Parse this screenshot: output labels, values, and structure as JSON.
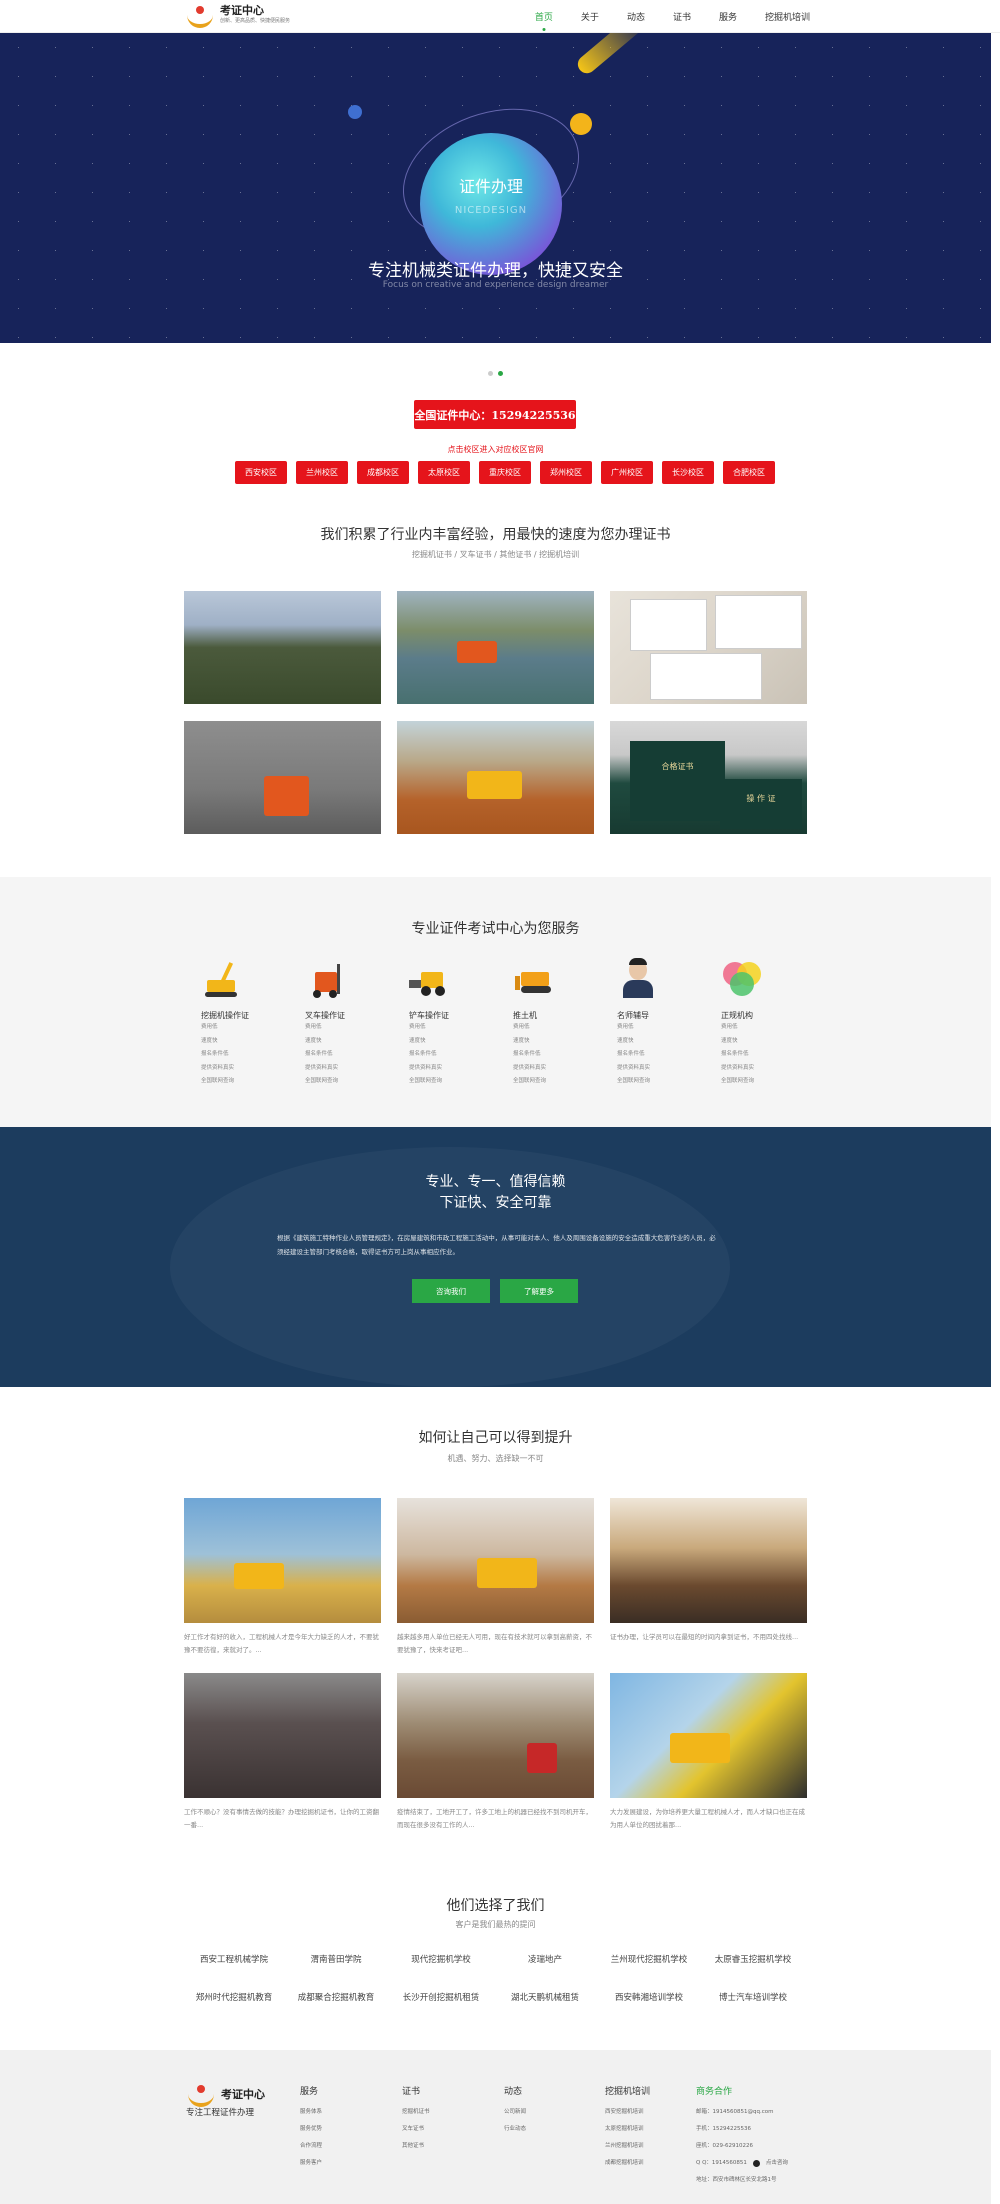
{
  "header": {
    "logo_title": "考证中心",
    "logo_tagline": "创新、更高品质、快捷便民服务",
    "nav": [
      "首页",
      "关于",
      "动态",
      "证书",
      "服务",
      "挖掘机培训"
    ]
  },
  "banner": {
    "globe_title": "证件办理",
    "globe_sub": "NICEDESIGN",
    "title": "专注机械类证件办理，快捷又安全",
    "subtitle": "Focus on creative and experience design dreamer"
  },
  "hotline": "全国证件中心：15294225536",
  "campus_link": "点击校区进入对应校区官网",
  "campuses": [
    "西安校区",
    "兰州校区",
    "成都校区",
    "太原校区",
    "重庆校区",
    "郑州校区",
    "广州校区",
    "长沙校区",
    "合肥校区"
  ],
  "experience": {
    "title": "我们积累了行业内丰富经验，用最快的速度为您办理证书",
    "tags": "挖掘机证书 / 叉车证书 / 其他证书 / 挖掘机培训"
  },
  "services": {
    "title": "专业证件考试中心为您服务",
    "items": [
      {
        "name": "挖掘机操作证",
        "icon": "excavator-icon"
      },
      {
        "name": "叉车操作证",
        "icon": "forklift-icon"
      },
      {
        "name": "铲车操作证",
        "icon": "loader-icon"
      },
      {
        "name": "推土机",
        "icon": "bulldozer-icon"
      },
      {
        "name": "名师辅导",
        "icon": "teacher-icon"
      },
      {
        "name": "正规机构",
        "icon": "circles-icon"
      }
    ],
    "sub_items": [
      "费用低",
      "速度快",
      "报名条件低",
      "提供资料真实",
      "全国联网查询"
    ]
  },
  "trust": {
    "line1": "专业、专一、值得信赖",
    "line2": "下证快、安全可靠",
    "paragraph": "根据《建筑施工特种作业人员管理规定》，在房屋建筑和市政工程施工活动中，从事可能对本人、他人及周围设备设施的安全造成重大危害作业的人员，必须经建设主管部门考核合格，取得证书方可上岗从事相应作业。",
    "btn_contact": "咨询我们",
    "btn_more": "了解更多"
  },
  "improve": {
    "title": "如何让自己可以得到提升",
    "subtitle": "机遇、努力、选择缺一不可",
    "items": [
      "好工作才有好的收入，工程机械人才是今年大力缺乏的人才，不要犹豫不要彷徨，来就对了。...",
      "越来越多用人单位已经无人可用，现在有技术就可以拿到高薪资，不要犹豫了，快来考证吧...",
      "证书办理，让学员可以在最短的时间内拿到证书，不用四处找线...",
      "工作不顺心？没有事情去做的技能？办理挖掘机证书，让你的工资翻一番...",
      "疫情结束了，工地开工了，许多工地上的机器已经找不到司机开车，而现在很多没有工作的人...",
      "大力发展建设，为你培养更大量工程机械人才，而人才缺口也正在成为用人单位的困扰着那..."
    ]
  },
  "clients": {
    "title": "他们选择了我们",
    "subtitle": "客户是我们最热的提问",
    "names": [
      "西安工程机械学院",
      "渭南普田学院",
      "现代挖掘机学校",
      "凌瑞地产",
      "兰州现代挖掘机学校",
      "太原睿玉挖掘机学校",
      "郑州时代挖掘机教育",
      "成都聚合挖掘机教育",
      "长沙开创挖掘机租赁",
      "湖北天鹏机械租赁",
      "西安韩湘培训学校",
      "博士汽车培训学校"
    ]
  },
  "footer": {
    "logo_title": "考证中心",
    "slogan": "专注工程证件办理",
    "columns": [
      {
        "title": "服务",
        "links": [
          "服务体系",
          "服务优势",
          "合作流程",
          "服务客户"
        ]
      },
      {
        "title": "证书",
        "links": [
          "挖掘机证书",
          "叉车证书",
          "其他证书"
        ]
      },
      {
        "title": "动态",
        "links": [
          "公司新闻",
          "行业动态"
        ]
      },
      {
        "title": "挖掘机培训",
        "links": [
          "西安挖掘机培训",
          "太原挖掘机培训",
          "兰州挖掘机培训",
          "成都挖掘机培训"
        ]
      }
    ],
    "contact": {
      "title": "商务合作",
      "email": "邮箱：1914560851@qq.com",
      "phone": "手机：15294225536",
      "tel": "座机：029-62910226",
      "qq": "Q Q：1914560851",
      "qq_label": "点击咨询",
      "address": "地址：西安市碑林区长安北路1号"
    }
  }
}
